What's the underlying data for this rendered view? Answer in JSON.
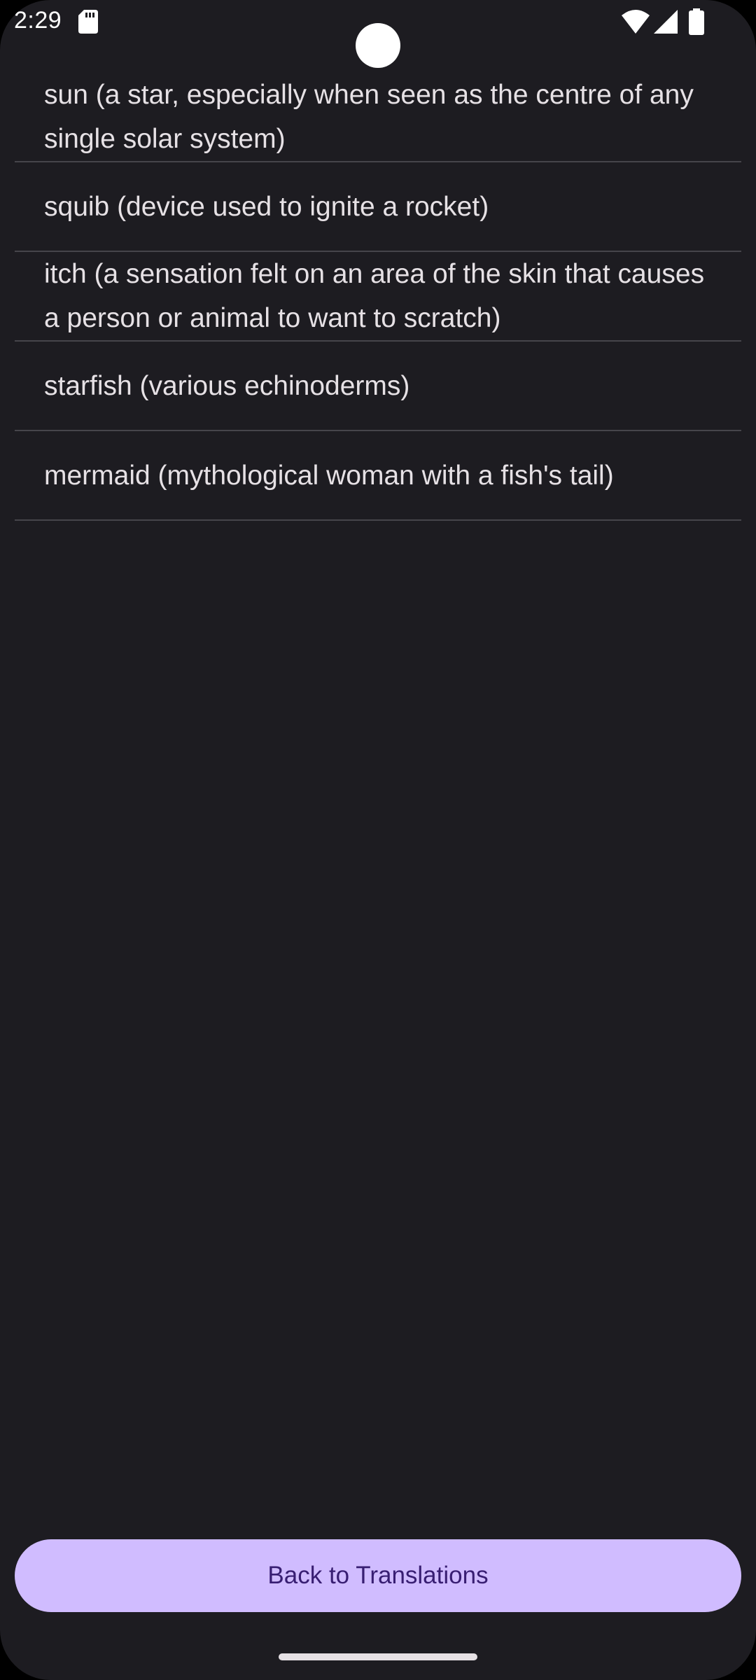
{
  "status_bar": {
    "time": "2:29",
    "icons": [
      "sd-card-icon",
      "wifi-icon",
      "signal-icon",
      "battery-icon"
    ]
  },
  "translations": [
    "sun (a star, especially when seen as the centre of any single solar system)",
    "squib (device used to ignite a rocket)",
    "itch (a sensation felt on an area of the skin that causes a person or animal to want to scratch)",
    "starfish (various echinoderms)",
    "mermaid (mythological woman with a fish's tail)"
  ],
  "back_button": {
    "label": "Back to Translations"
  },
  "colors": {
    "background": "#1d1c21",
    "text": "#e6e1e5",
    "divider": "#46454b",
    "button_bg": "#d0bcff",
    "button_text": "#381e72"
  }
}
